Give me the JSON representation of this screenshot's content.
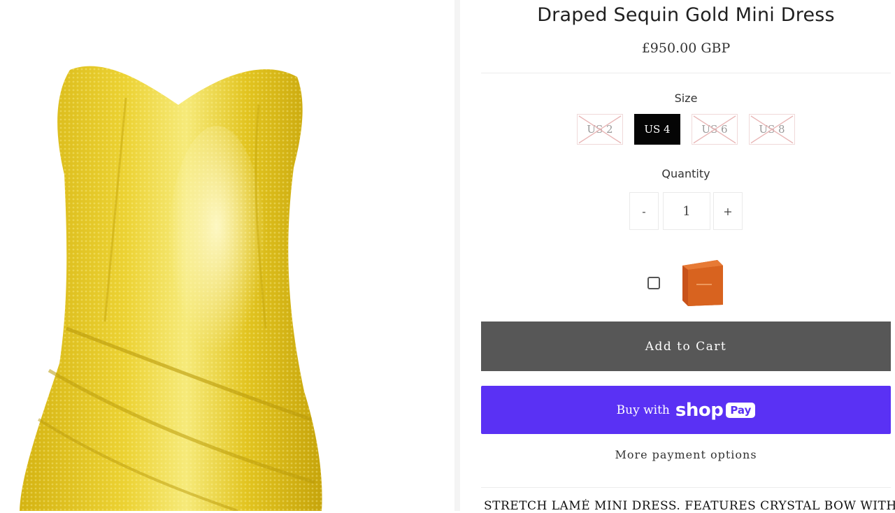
{
  "product": {
    "image_alt": "product-photo",
    "title": "Draped Sequin Gold Mini Dress",
    "price": "£950.00 GBP"
  },
  "size": {
    "label": "Size",
    "options": [
      {
        "label": "US 2",
        "available": false
      },
      {
        "label": "US 4",
        "available": true,
        "selected": true
      },
      {
        "label": "US 6",
        "available": false
      },
      {
        "label": "US 8",
        "available": false
      }
    ]
  },
  "quantity": {
    "label": "Quantity",
    "decrement": "-",
    "value": "1",
    "increment": "+"
  },
  "addon": {
    "checked": false,
    "icon": "gift-box-image"
  },
  "buttons": {
    "add_to_cart": "Add to Cart",
    "buy_with": "Buy with",
    "shop_word": "shop",
    "pay_badge": "Pay",
    "more_payment_options": "More payment options"
  },
  "description": "STRETCH LAMÉ MINI DRESS. FEATURES CRYSTAL BOW WITH",
  "colors": {
    "add_to_cart_bg": "#575757",
    "shop_pay_bg": "#5a31f4",
    "selected_size_bg": "#050505",
    "dress_gold": "#e2c21a"
  }
}
